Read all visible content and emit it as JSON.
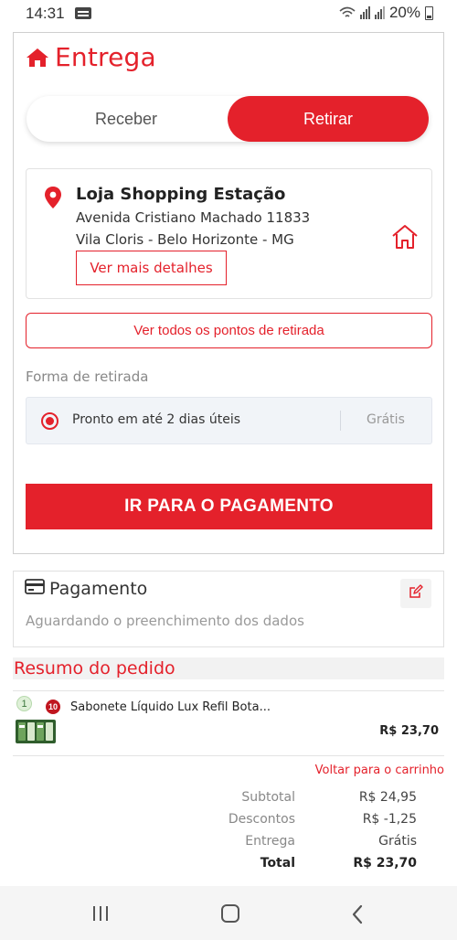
{
  "status_bar": {
    "time": "14:31",
    "battery": "20%"
  },
  "delivery": {
    "title": "Entrega",
    "toggle": {
      "receive_label": "Receber",
      "pickup_label": "Retirar",
      "selected": "Retirar"
    },
    "store": {
      "name": "Loja Shopping Estação",
      "address_line1": "Avenida Cristiano Machado 11833",
      "address_line2": "Vila Cloris - Belo Horizonte - MG",
      "details_button": "Ver mais detalhes"
    },
    "all_points_button": "Ver todos os pontos de retirada",
    "pickup_method_label": "Forma de retirada",
    "pickup_option": {
      "text": "Pronto em até 2 dias úteis",
      "price": "Grátis",
      "selected": true
    },
    "cta": "IR PARA O PAGAMENTO"
  },
  "payment": {
    "title": "Pagamento",
    "subtitle": "Aguardando o preenchimento dos dados"
  },
  "summary": {
    "title": "Resumo do pedido",
    "items": [
      {
        "qty": "1",
        "badge": "10",
        "name": "Sabonete Líquido Lux Refil Bota...",
        "price": "R$ 23,70"
      }
    ],
    "back_to_cart": "Voltar para o carrinho",
    "totals": [
      {
        "label": "Subtotal",
        "value": "R$ 24,95"
      },
      {
        "label": "Descontos",
        "value": "R$ -1,25"
      },
      {
        "label": "Entrega",
        "value": "Grátis"
      },
      {
        "label": "Total",
        "value": "R$ 23,70"
      }
    ]
  },
  "colors": {
    "accent": "#e4212b",
    "muted_text": "#888888",
    "option_bg": "#f1f4f8"
  },
  "icons": {
    "title": "home-icon",
    "store": "map-pin-icon",
    "store_action": "house-outline-icon",
    "payment": "credit-card-icon",
    "edit": "edit-icon"
  }
}
